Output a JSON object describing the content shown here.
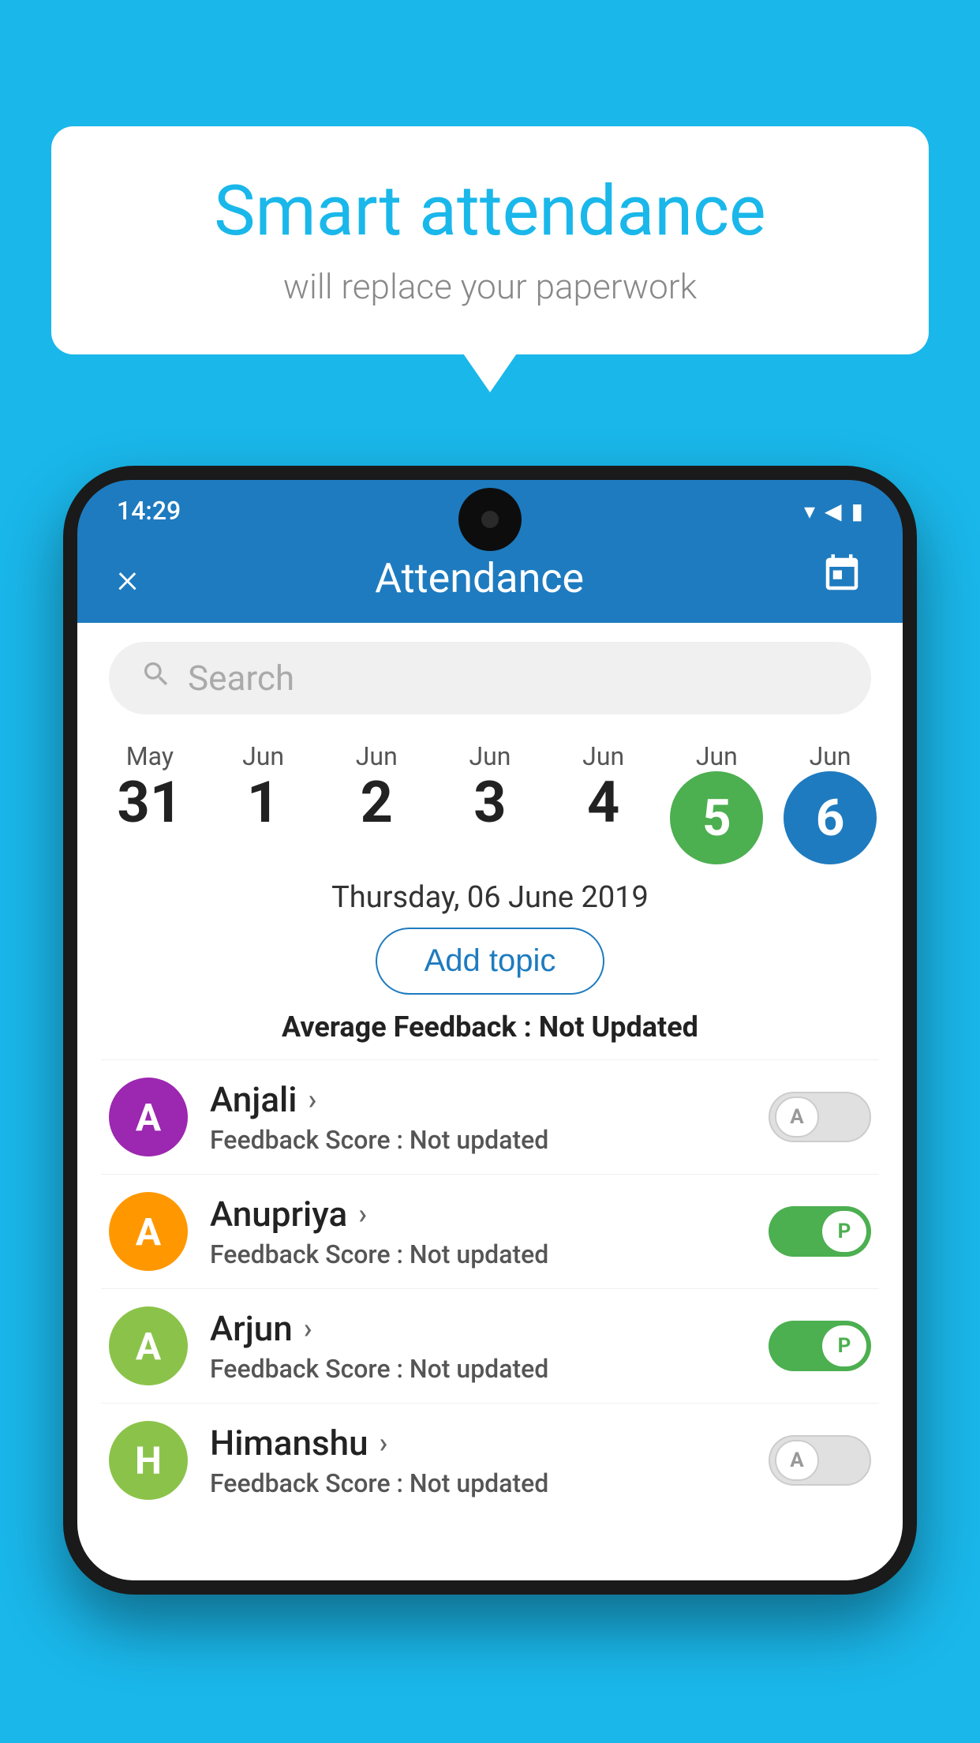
{
  "background_color": "#1ab7ea",
  "bubble": {
    "title": "Smart attendance",
    "subtitle": "will replace your paperwork"
  },
  "status_bar": {
    "time": "14:29",
    "wifi": "▾",
    "signal": "▲",
    "battery": "▮"
  },
  "header": {
    "title": "Attendance",
    "close_label": "×",
    "calendar_icon": "📅"
  },
  "search": {
    "placeholder": "Search"
  },
  "calendar": {
    "days": [
      {
        "month": "May",
        "date": "31",
        "type": "normal"
      },
      {
        "month": "Jun",
        "date": "1",
        "type": "normal"
      },
      {
        "month": "Jun",
        "date": "2",
        "type": "normal"
      },
      {
        "month": "Jun",
        "date": "3",
        "type": "normal"
      },
      {
        "month": "Jun",
        "date": "4",
        "type": "normal"
      },
      {
        "month": "Jun",
        "date": "5",
        "type": "green"
      },
      {
        "month": "Jun",
        "date": "6",
        "type": "blue"
      }
    ]
  },
  "selected_date": "Thursday, 06 June 2019",
  "add_topic_label": "Add topic",
  "average_feedback": {
    "label": "Average Feedback : ",
    "value": "Not Updated"
  },
  "students": [
    {
      "name": "Anjali",
      "initial": "A",
      "avatar_color": "purple",
      "feedback_label": "Feedback Score : ",
      "feedback_value": "Not updated",
      "toggle_state": "off",
      "toggle_letter": "A"
    },
    {
      "name": "Anupriya",
      "initial": "A",
      "avatar_color": "orange",
      "feedback_label": "Feedback Score : ",
      "feedback_value": "Not updated",
      "toggle_state": "on",
      "toggle_letter": "P"
    },
    {
      "name": "Arjun",
      "initial": "A",
      "avatar_color": "green",
      "feedback_label": "Feedback Score : ",
      "feedback_value": "Not updated",
      "toggle_state": "on",
      "toggle_letter": "P"
    },
    {
      "name": "Himanshu",
      "initial": "H",
      "avatar_color": "olive",
      "feedback_label": "Feedback Score : ",
      "feedback_value": "Not updated",
      "toggle_state": "off",
      "toggle_letter": "A"
    }
  ]
}
